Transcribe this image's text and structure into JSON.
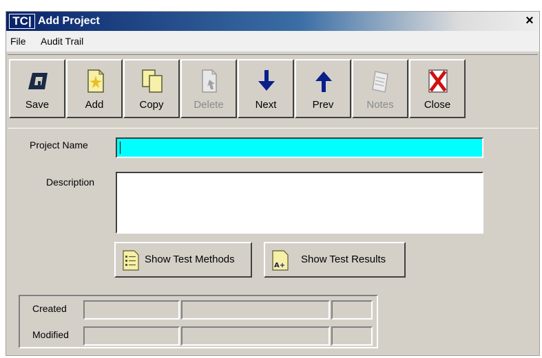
{
  "window": {
    "logo_text": "TC|",
    "title": "Add Project",
    "close_glyph": "×"
  },
  "menu": {
    "items": [
      "File",
      "Audit Trail"
    ]
  },
  "toolbar": {
    "buttons": [
      {
        "label": "Save",
        "icon": "save-icon",
        "enabled": true
      },
      {
        "label": "Add",
        "icon": "add-document-icon",
        "enabled": true
      },
      {
        "label": "Copy",
        "icon": "copy-icon",
        "enabled": true
      },
      {
        "label": "Delete",
        "icon": "delete-icon",
        "enabled": false
      },
      {
        "label": "Next",
        "icon": "arrow-down-icon",
        "enabled": true
      },
      {
        "label": "Prev",
        "icon": "arrow-up-icon",
        "enabled": true
      },
      {
        "label": "Notes",
        "icon": "notes-icon",
        "enabled": false
      },
      {
        "label": "Close",
        "icon": "close-x-icon",
        "enabled": true
      }
    ]
  },
  "form": {
    "project_name_label": "Project Name",
    "project_name_value": "",
    "description_label": "Description",
    "description_value": ""
  },
  "actions": {
    "show_test_methods": "Show Test Methods",
    "show_test_results": "Show Test Results"
  },
  "audit": {
    "created_label": "Created",
    "modified_label": "Modified",
    "created_values": [
      "",
      "",
      ""
    ],
    "modified_values": [
      "",
      "",
      ""
    ]
  },
  "colors": {
    "title_bar": "#0a246a",
    "highlight_input": "#00ffff",
    "face": "#d4d0c8"
  }
}
